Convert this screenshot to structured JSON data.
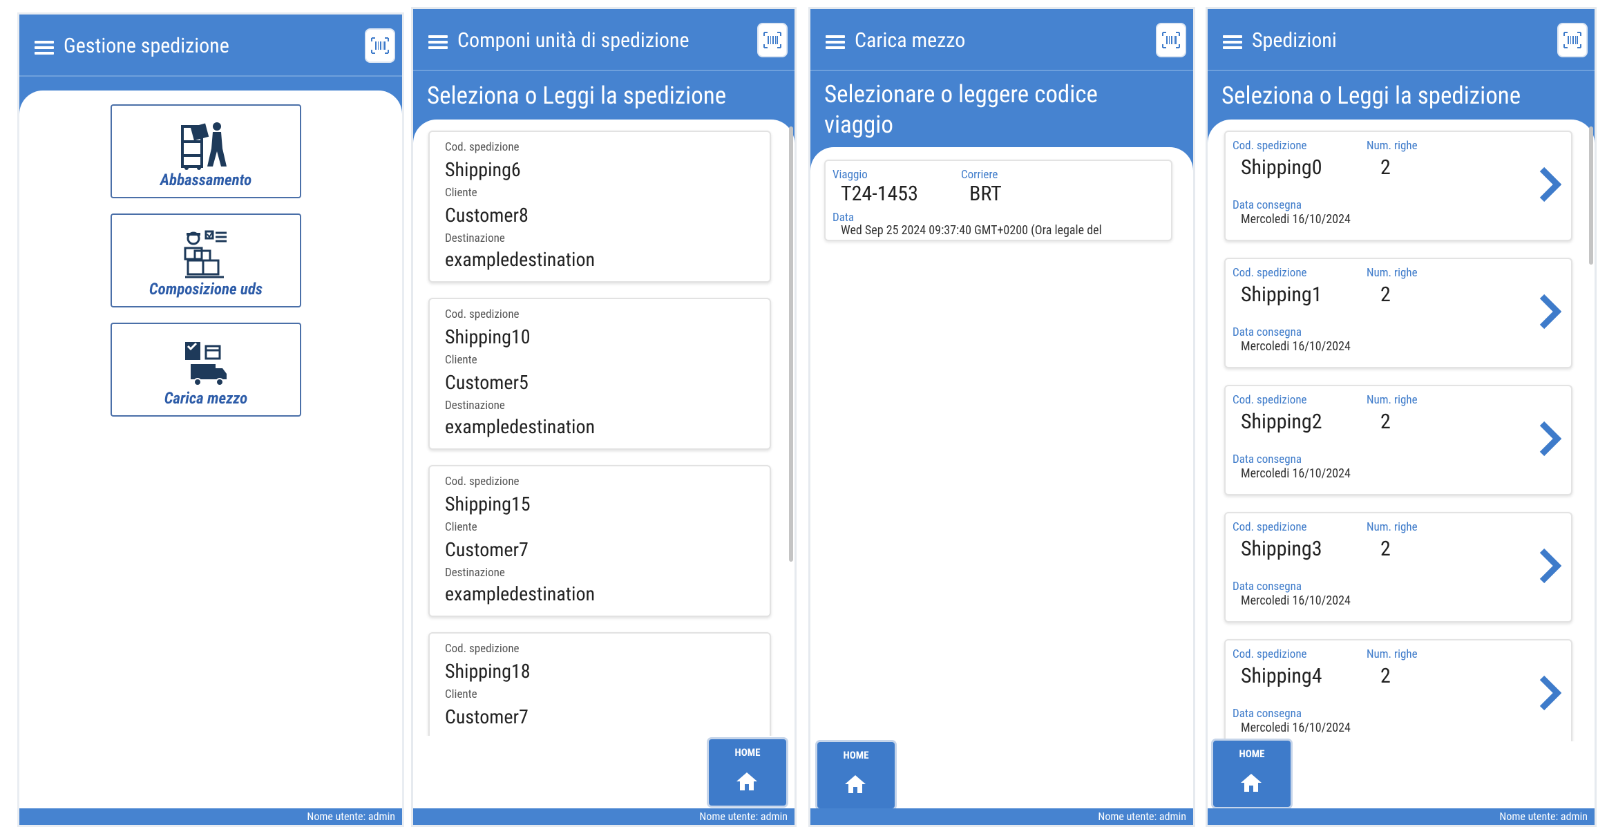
{
  "colors": {
    "primary": "#4683d0",
    "tile_text": "#2d5ca8",
    "label_blue": "#3e7bca"
  },
  "footer_user": "Nome utente: admin",
  "home_label": "HOME",
  "screen1": {
    "title": "Gestione spedizione",
    "tiles": [
      {
        "label": "Abbassamento",
        "icon": "warehouse-worker-icon"
      },
      {
        "label": "Composizione uds",
        "icon": "package-composition-icon"
      },
      {
        "label": "Carica mezzo",
        "icon": "truck-loading-icon"
      }
    ]
  },
  "screen2": {
    "title": "Componi unità di spedizione",
    "subtitle": "Seleziona o Leggi la spedizione",
    "labels": {
      "code": "Cod. spedizione",
      "customer": "Cliente",
      "destination": "Destinazione"
    },
    "cards": [
      {
        "code": "Shipping6",
        "customer": "Customer8",
        "destination": "exampledestination"
      },
      {
        "code": "Shipping10",
        "customer": "Customer5",
        "destination": "exampledestination"
      },
      {
        "code": "Shipping15",
        "customer": "Customer7",
        "destination": "exampledestination"
      },
      {
        "code": "Shipping18",
        "customer": "Customer7",
        "destination": ""
      }
    ]
  },
  "screen3": {
    "title": "Carica mezzo",
    "subtitle_line1": "Selezionare o leggere codice",
    "subtitle_line2": "viaggio",
    "labels": {
      "trip": "Viaggio",
      "carrier": "Corriere",
      "date": "Data"
    },
    "trip": {
      "code": "T24-1453",
      "carrier": "BRT",
      "date": "Wed Sep 25 2024 09:37:40 GMT+0200 (Ora legale del"
    }
  },
  "screen4": {
    "title": "Spedizioni",
    "subtitle": "Seleziona o Leggi la spedizione",
    "labels": {
      "code": "Cod. spedizione",
      "rows": "Num. righe",
      "delivery": "Data consegna"
    },
    "cards": [
      {
        "code": "Shipping0",
        "rows": "2",
        "delivery": "Mercoledi 16/10/2024"
      },
      {
        "code": "Shipping1",
        "rows": "2",
        "delivery": "Mercoledi 16/10/2024"
      },
      {
        "code": "Shipping2",
        "rows": "2",
        "delivery": "Mercoledi 16/10/2024"
      },
      {
        "code": "Shipping3",
        "rows": "2",
        "delivery": "Mercoledi 16/10/2024"
      },
      {
        "code": "Shipping4",
        "rows": "2",
        "delivery": "Mercoledi 16/10/2024"
      }
    ]
  }
}
